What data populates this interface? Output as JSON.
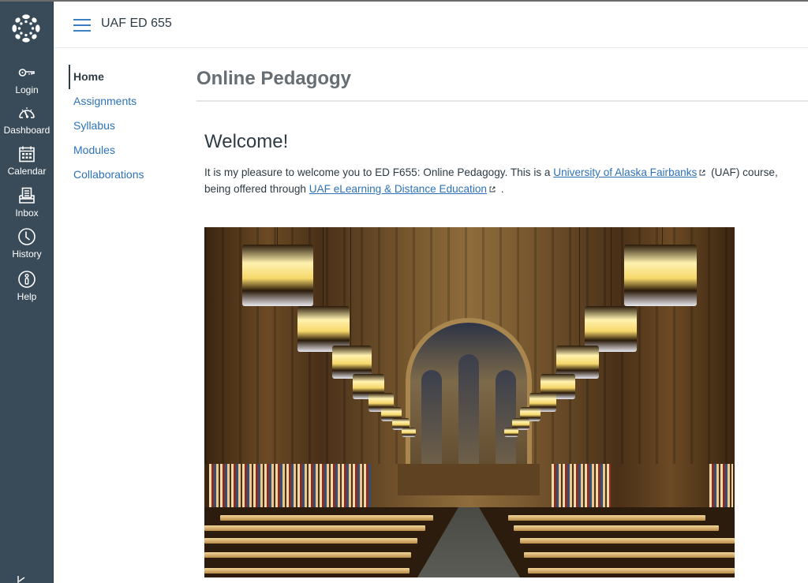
{
  "global_nav": {
    "logo": "canvas-logo",
    "items": [
      {
        "label": "Login",
        "icon": "key-icon"
      },
      {
        "label": "Dashboard",
        "icon": "dashboard-gauge-icon"
      },
      {
        "label": "Calendar",
        "icon": "calendar-icon"
      },
      {
        "label": "Inbox",
        "icon": "inbox-icon"
      },
      {
        "label": "History",
        "icon": "clock-icon"
      },
      {
        "label": "Help",
        "icon": "info-icon"
      }
    ],
    "collapse_icon": "collapse-arrow-icon"
  },
  "header": {
    "menu_icon": "hamburger-icon",
    "course_title": "UAF ED 655"
  },
  "course_nav": {
    "items": [
      {
        "label": "Home",
        "active": true
      },
      {
        "label": "Assignments",
        "active": false
      },
      {
        "label": "Syllabus",
        "active": false
      },
      {
        "label": "Modules",
        "active": false
      },
      {
        "label": "Collaborations",
        "active": false
      }
    ]
  },
  "content": {
    "page_title": "Online Pedagogy",
    "welcome_heading": "Welcome!",
    "intro": {
      "text_1": "It is my pleasure to welcome you to ED F655: Online Pedagogy. This is a ",
      "link_1": "University of Alaska Fairbanks",
      "text_2": " (UAF) course, being offered through ",
      "link_2": "UAF eLearning & Distance Education",
      "text_3": " ."
    },
    "image_alt": "Gothic library reading room with hanging lanterns and long study tables"
  },
  "colors": {
    "nav_bg": "#394b58",
    "link": "#2d72b8",
    "text": "#2d3b45",
    "title_gray": "#666e73"
  }
}
